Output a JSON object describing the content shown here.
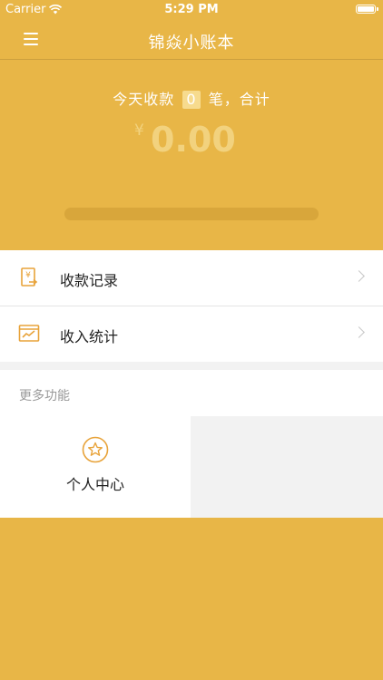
{
  "status_bar": {
    "carrier": "Carrier",
    "time": "5:29 PM"
  },
  "nav": {
    "title": "锦焱小账本"
  },
  "summary": {
    "prefix": "今天收款",
    "count": "0",
    "suffix": "笔，合计",
    "currency": "¥",
    "amount": "0.00",
    "progress": 0
  },
  "menu_items": [
    {
      "label": "收款记录",
      "icon": "receipt-yen-icon"
    },
    {
      "label": "收入统计",
      "icon": "line-chart-icon"
    }
  ],
  "more": {
    "header": "更多功能",
    "items": [
      {
        "label": "个人中心",
        "icon": "star-circle-icon"
      }
    ]
  },
  "colors": {
    "brand": "#E8B647",
    "accent": "#E8A33A",
    "amount": "#F2D27E"
  }
}
